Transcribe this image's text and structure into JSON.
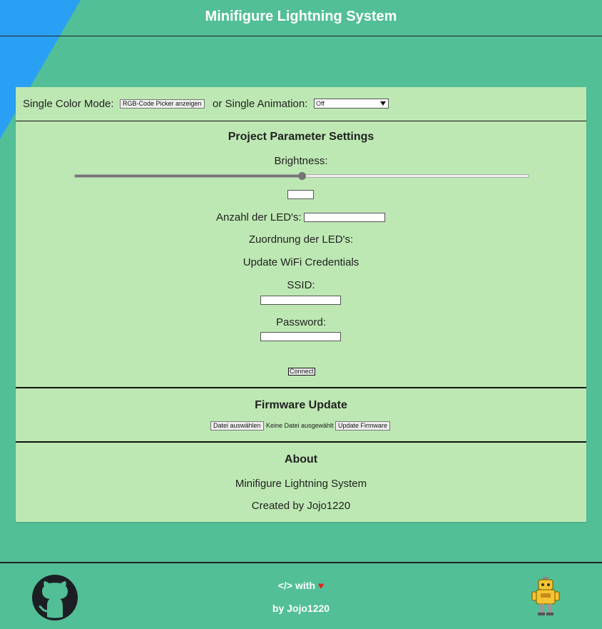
{
  "header": {
    "title": "Minifigure Lightning System"
  },
  "mode": {
    "single_color_label": "Single Color Mode:",
    "rgb_button": "RGB-Code Picker anzeigen",
    "or_label": "or Single Animation:",
    "animation_selected": "Off"
  },
  "settings": {
    "title": "Project Parameter Settings",
    "brightness_label": "Brightness:",
    "brightness_value": 50,
    "brightness_max": 100,
    "led_count_label": "Anzahl der LED's:",
    "led_mapping_label": "Zuordnung der LED's:",
    "wifi_title": "Update WiFi Credentials",
    "ssid_label": "SSID:",
    "password_label": "Password:",
    "connect_button": "Connect"
  },
  "firmware": {
    "title": "Firmware Update",
    "choose_file_button": "Datei auswählen",
    "no_file_text": "Keine Datei ausgewählt",
    "update_button": "Update Firmware"
  },
  "about": {
    "title": "About",
    "line1": "Minifigure Lightning System",
    "line2": "Created by Jojo1220"
  },
  "footer": {
    "code_symbol": "</>",
    "with_text": "with",
    "heart": "♥",
    "by_line": "by Jojo1220"
  },
  "colors": {
    "background": "#52bf96",
    "panel": "#bde8b3",
    "corner": "#2aa0f5",
    "heart": "#e0241b"
  },
  "icons": {
    "left_footer": "github-icon",
    "right_footer": "robot-icon"
  }
}
